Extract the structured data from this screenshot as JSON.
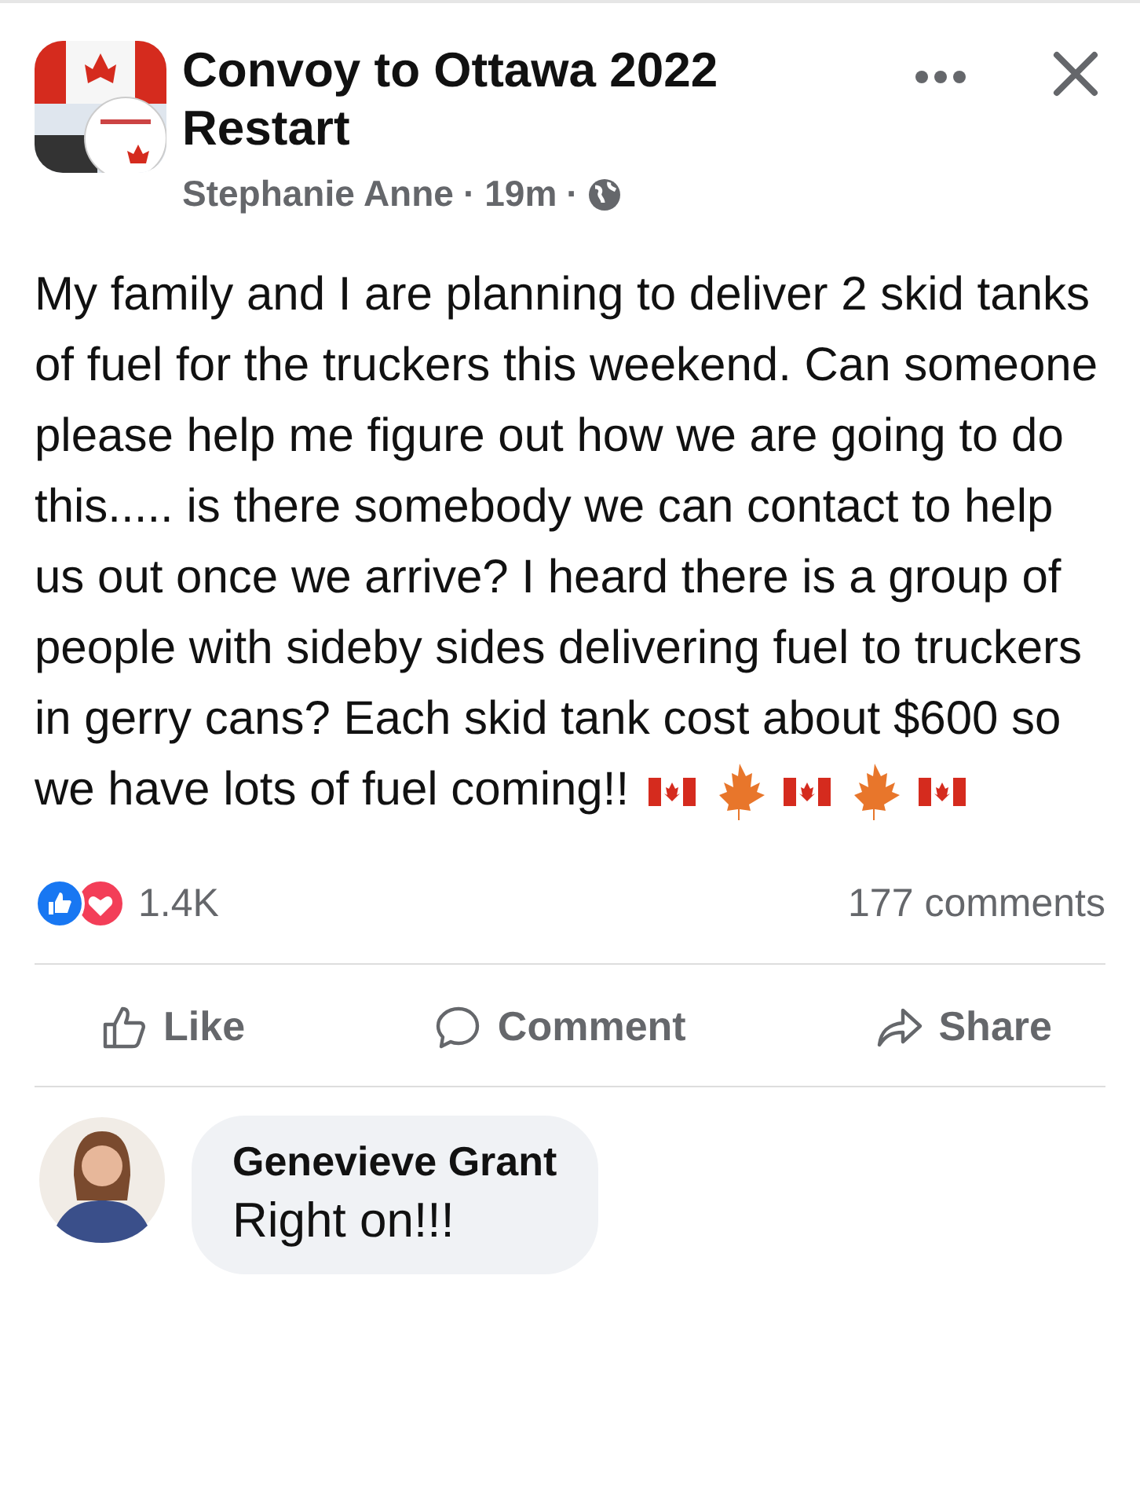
{
  "post": {
    "group": "Convoy to Ottawa 2022 Restart",
    "author": "Stephanie Anne",
    "separator_1": "·",
    "time": "19m",
    "separator_2": "·",
    "body": "My family and I are planning to deliver 2 skid tanks of fuel for the truckers this weekend. Can someone please help me figure out how we are going to do this..... is there somebody we can contact to help us out once we arrive? I heard there is a group of people with sideby sides delivering fuel to truckers in gerry cans? Each skid tank cost about $600 so we have lots of fuel coming!!",
    "emoji": [
      {
        "kind": "flag"
      },
      {
        "kind": "leaf"
      },
      {
        "kind": "flag"
      },
      {
        "kind": "leaf"
      },
      {
        "kind": "flag"
      }
    ],
    "reactions": "1.4K",
    "comments_count": "177 comments"
  },
  "actions": [
    {
      "kind": "like",
      "label": "Like"
    },
    {
      "kind": "comment",
      "label": "Comment"
    },
    {
      "kind": "share",
      "label": "Share"
    }
  ],
  "comment": {
    "author": "Genevieve Grant",
    "text": "Right on!!!"
  }
}
